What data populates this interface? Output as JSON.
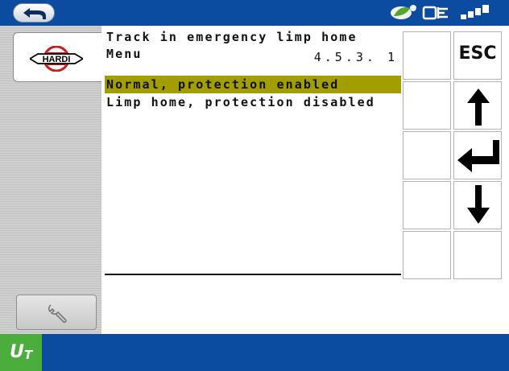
{
  "header": {
    "back_icon": "back-arrow-icon",
    "status_icons": [
      "leaf-eye-icon",
      "connection-icon",
      "signal-icon"
    ]
  },
  "sidebar": {
    "logo_text": "HARDI",
    "tool_icon": "wrench-icon"
  },
  "screen": {
    "title_line1": "Track in emergency limp home",
    "title_line2": "Menu",
    "version": "4.5.3. 1",
    "options": [
      {
        "label": "Normal, protection enabled",
        "selected": true
      },
      {
        "label": "Limp home, protection disabled",
        "selected": false
      }
    ]
  },
  "softkeys": {
    "esc_label": "ESC",
    "up_icon": "arrow-up-icon",
    "enter_icon": "enter-icon",
    "down_icon": "arrow-down-icon"
  },
  "footer": {
    "logo_main": "U",
    "logo_sub": "T"
  },
  "colors": {
    "bar_blue": "#0c4ca0",
    "selection": "#a39e00",
    "ut_green": "#4bae3c"
  }
}
